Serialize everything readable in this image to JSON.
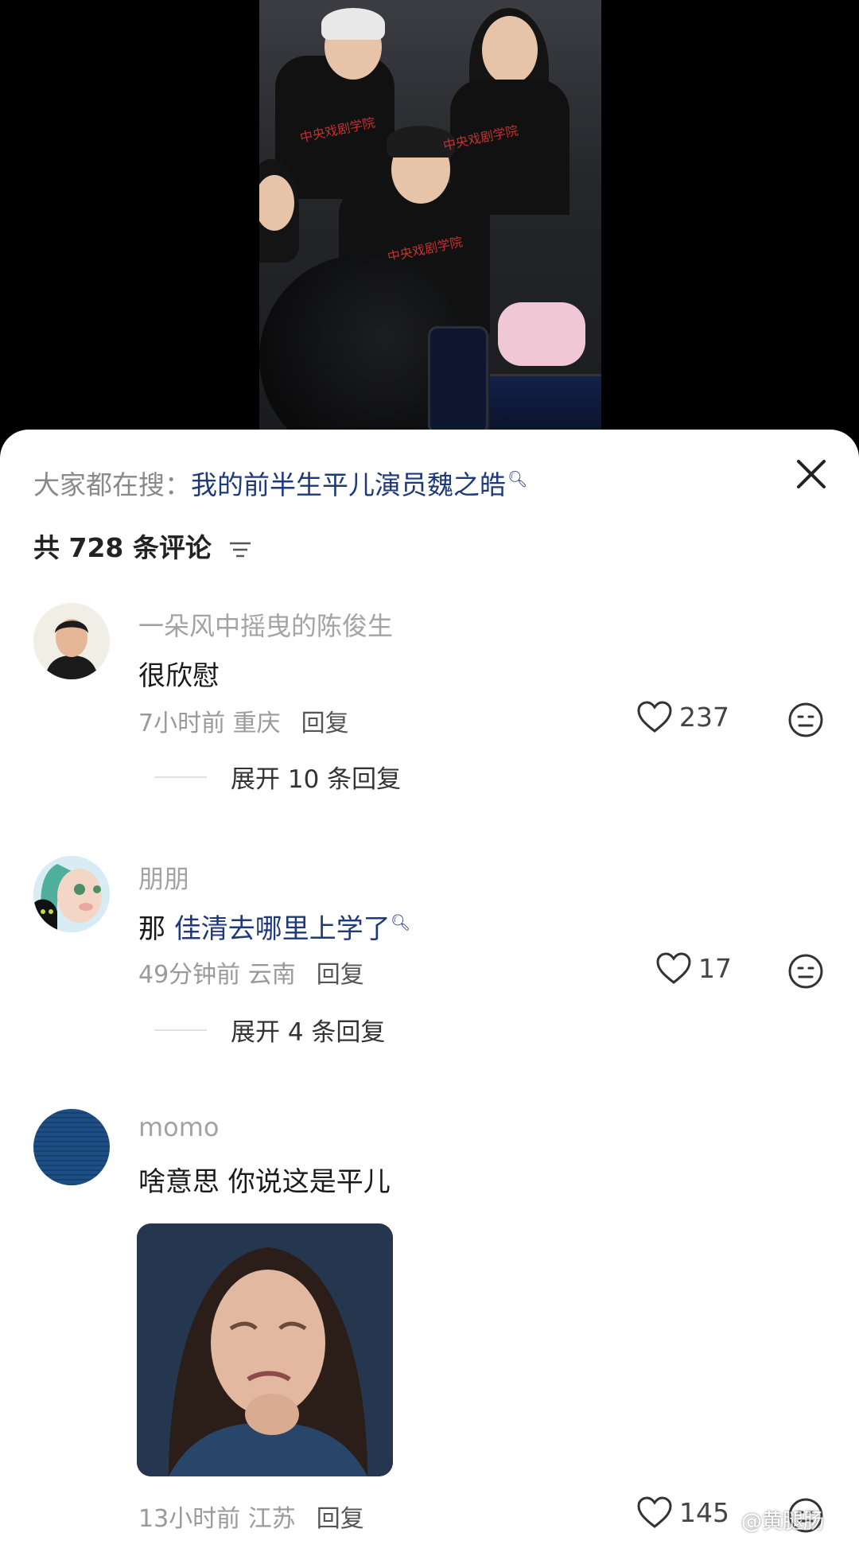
{
  "hot_search": {
    "label": "大家都在搜：",
    "query": "我的前半生平儿演员魏之皓"
  },
  "comment_count": "共 728 条评论",
  "comments": [
    {
      "username": "一朵风中摇曳的陈俊生",
      "text": "很欣慰",
      "time_location": "7小时前 重庆",
      "reply_label": "回复",
      "likes": "237",
      "expand_label": "展开 10 条回复"
    },
    {
      "username": "朋朋",
      "text_prefix": "那 ",
      "text_link": "佳清去哪里上学了",
      "time_location": "49分钟前 云南",
      "reply_label": "回复",
      "likes": "17",
      "expand_label": "展开 4 条回复"
    },
    {
      "username": "momo",
      "text": "啥意思 你说这是平儿",
      "time_location": "13小时前 江苏",
      "reply_label": "回复",
      "likes": "145"
    }
  ],
  "watermark": "@黄腿肠",
  "colors": {
    "link": "#1f3a7a",
    "muted": "#9a9a9a",
    "sheet_bg": "#ffffff"
  }
}
